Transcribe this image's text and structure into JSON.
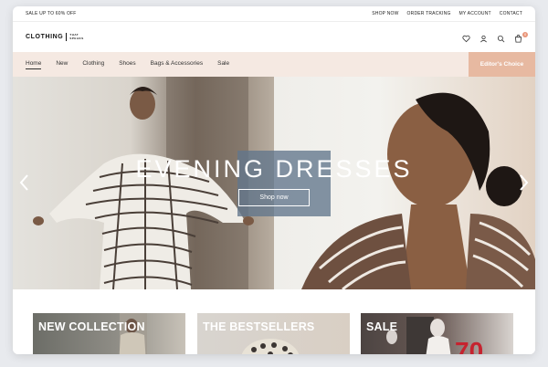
{
  "topbar": {
    "promo": "SALE UP TO 60% OFF",
    "links": [
      "SHOP NOW",
      "ORDER TRACKING",
      "MY ACCOUNT",
      "CONTACT"
    ]
  },
  "header": {
    "logo_main": "CLOTHING",
    "logo_sub_1": "THAT",
    "logo_sub_2": "SPEAKS",
    "cart_count": "0"
  },
  "nav": {
    "items": [
      "Home",
      "New",
      "Clothing",
      "Shoes",
      "Bags & Accessories",
      "Sale"
    ],
    "editors_choice": "Editor's Choice"
  },
  "hero": {
    "title": "EVENING DRESSES",
    "cta": "Shop now"
  },
  "categories": [
    {
      "label": "NEW COLLECTION"
    },
    {
      "label": "THE BESTSELLERS"
    },
    {
      "label": "SALE",
      "badge": "70"
    }
  ],
  "colors": {
    "accent": "#e7b9a1",
    "nav_bg": "#f5e9e2",
    "overlay": "#61768c"
  }
}
